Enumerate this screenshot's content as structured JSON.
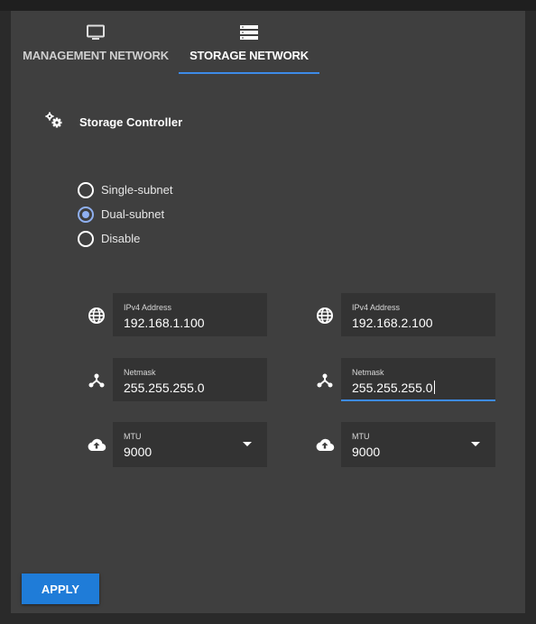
{
  "tabs": [
    {
      "label": "MANAGEMENT NETWORK",
      "icon": "monitor-icon",
      "active": false
    },
    {
      "label": "STORAGE NETWORK",
      "icon": "server-icon",
      "active": true
    }
  ],
  "section": {
    "title": "Storage Controller",
    "icon": "gears-icon"
  },
  "mode": {
    "options": [
      "Single-subnet",
      "Dual-subnet",
      "Disable"
    ],
    "selected": "Dual-subnet"
  },
  "subnet1": {
    "ipv4": {
      "label": "IPv4 Address",
      "value": "192.168.1.100",
      "icon": "globe-icon"
    },
    "netmask": {
      "label": "Netmask",
      "value": "255.255.255.0",
      "icon": "network-icon"
    },
    "mtu": {
      "label": "MTU",
      "value": "9000",
      "icon": "cloud-upload-icon"
    }
  },
  "subnet2": {
    "ipv4": {
      "label": "IPv4 Address",
      "value": "192.168.2.100",
      "icon": "globe-icon"
    },
    "netmask": {
      "label": "Netmask",
      "value": "255.255.255.0",
      "icon": "network-icon"
    },
    "mtu": {
      "label": "MTU",
      "value": "9000",
      "icon": "cloud-upload-icon"
    }
  },
  "apply_label": "APPLY",
  "colors": {
    "accent": "#3d8be8",
    "button": "#1f7cd8",
    "panel": "#3f3f3f",
    "field": "#333333",
    "radio_checked": "#8fb0f0"
  }
}
